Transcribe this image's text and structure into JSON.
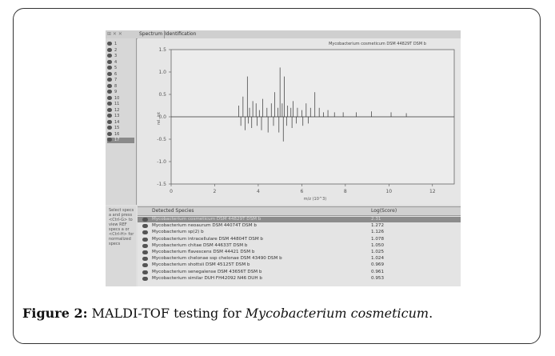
{
  "app": {
    "tabs": [
      "Spectrum",
      "Identification"
    ],
    "window_controls": "⊞ ✕ ✕"
  },
  "sample_list": [
    "1",
    "2",
    "3",
    "4",
    "5",
    "6",
    "7",
    "8",
    "9",
    "10",
    "11",
    "12",
    "13",
    "14",
    "15",
    "16",
    "17"
  ],
  "spectrum": {
    "title": "Mycobacterium cosmeticum DSM 44829T DSM b",
    "ylabel": "rel. int",
    "xlabel": "m/z (10^3)",
    "y_ticks": [
      "1.5",
      "1.0",
      "0.5",
      "0.0",
      "-0.5",
      "-1.0",
      "-1.5"
    ],
    "x_ticks": [
      "0",
      "2",
      "4",
      "6",
      "8",
      "10",
      "12"
    ]
  },
  "chart_data": {
    "type": "bar",
    "xlim": [
      0,
      13
    ],
    "ylim": [
      -1.5,
      1.5
    ],
    "x_ticks": [
      0,
      2,
      4,
      6,
      8,
      10,
      12
    ],
    "y_ticks": [
      1.5,
      1.0,
      0.5,
      0.0,
      -0.5,
      -1.0,
      -1.5
    ],
    "peaks_up": [
      [
        3.1,
        0.25
      ],
      [
        3.3,
        0.45
      ],
      [
        3.5,
        0.9
      ],
      [
        3.6,
        0.2
      ],
      [
        3.75,
        0.35
      ],
      [
        3.9,
        0.3
      ],
      [
        4.05,
        0.15
      ],
      [
        4.2,
        0.4
      ],
      [
        4.4,
        0.2
      ],
      [
        4.6,
        0.3
      ],
      [
        4.75,
        0.55
      ],
      [
        4.9,
        0.2
      ],
      [
        5.0,
        1.1
      ],
      [
        5.1,
        0.3
      ],
      [
        5.2,
        0.9
      ],
      [
        5.35,
        0.25
      ],
      [
        5.5,
        0.2
      ],
      [
        5.6,
        0.35
      ],
      [
        5.8,
        0.2
      ],
      [
        6.0,
        0.15
      ],
      [
        6.2,
        0.3
      ],
      [
        6.4,
        0.2
      ],
      [
        6.6,
        0.55
      ],
      [
        6.8,
        0.2
      ],
      [
        7.0,
        0.1
      ],
      [
        7.2,
        0.15
      ],
      [
        7.5,
        0.1
      ],
      [
        7.9,
        0.1
      ],
      [
        8.5,
        0.1
      ],
      [
        9.2,
        0.12
      ],
      [
        10.1,
        0.1
      ],
      [
        10.8,
        0.08
      ]
    ],
    "peaks_down": [
      [
        3.2,
        -0.2
      ],
      [
        3.4,
        -0.3
      ],
      [
        3.55,
        -0.15
      ],
      [
        3.7,
        -0.25
      ],
      [
        3.95,
        -0.2
      ],
      [
        4.15,
        -0.3
      ],
      [
        4.45,
        -0.35
      ],
      [
        4.7,
        -0.2
      ],
      [
        4.95,
        -0.35
      ],
      [
        5.15,
        -0.55
      ],
      [
        5.3,
        -0.2
      ],
      [
        5.55,
        -0.25
      ],
      [
        5.75,
        -0.15
      ],
      [
        6.05,
        -0.2
      ],
      [
        6.3,
        -0.15
      ]
    ]
  },
  "side_help": "Select specs a and press <Ctrl-G> to view REF specs a or <Ctrl-H> for normalized specs",
  "results": {
    "headers": [
      "Detected Species",
      "Log(Score)"
    ],
    "rows": [
      {
        "species": "Mycobacterium cosmeticum DSM 44829T DSM b",
        "score": "2.31"
      },
      {
        "species": "Mycobacterium neoaurum DSM 44074T DSM b",
        "score": "1.272"
      },
      {
        "species": "Mycobacterium sp(2) b",
        "score": "1.126"
      },
      {
        "species": "Mycobacterium intracellulare DSM 44804T DSM b",
        "score": "1.078"
      },
      {
        "species": "Mycobacterium chitae DSM 44633T DSM b",
        "score": "1.050"
      },
      {
        "species": "Mycobacterium flavescens DSM 44421 DSM b",
        "score": "1.025"
      },
      {
        "species": "Mycobacterium chelonae ssp chelonae DSM 43490 DSM b",
        "score": "1.024"
      },
      {
        "species": "Mycobacterium shottsii DSM 45125T DSM b",
        "score": "0.969"
      },
      {
        "species": "Mycobacterium senegalense DSM 43656T DSM b",
        "score": "0.961"
      },
      {
        "species": "Mycobacterium similar DUH FH42092 N46 DUH b",
        "score": "0.953"
      }
    ]
  },
  "caption": {
    "label": "Figure 2:",
    "text": " MALDI-TOF testing for ",
    "organism": "Mycobacterium cosmeticum",
    "end": "."
  }
}
